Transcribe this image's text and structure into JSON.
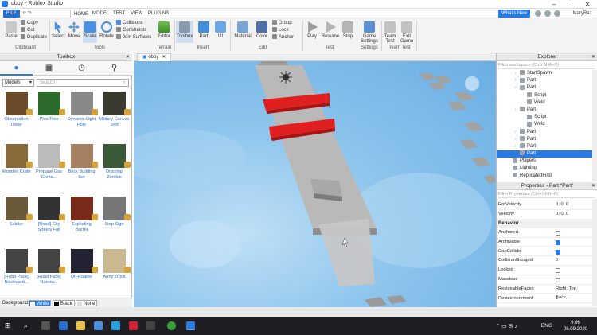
{
  "window": {
    "title": "obby - Roblox Studio"
  },
  "menu": {
    "tabs": [
      "FILE",
      "HOME",
      "MODEL",
      "TEST",
      "VIEW",
      "PLUGINS"
    ],
    "active": "HOME",
    "whats_new": "What's New",
    "user": "MaryRa1"
  },
  "ribbon": {
    "clipboard": {
      "paste": "Paste",
      "copy": "Copy",
      "cut": "Cut",
      "duplicate": "Duplicate",
      "label": "Clipboard"
    },
    "tools": {
      "select": "Select",
      "move": "Move",
      "scale": "Scale",
      "rotate": "Rotate",
      "label": "Tools"
    },
    "options": {
      "collisions": "Collisions",
      "constraints": "Constraints",
      "join_surfaces": "Join Surfaces"
    },
    "terrain": {
      "editor": "Editor",
      "label": "Terrain"
    },
    "insert": {
      "toolbox": "Toolbox",
      "part": "Part",
      "ui": "UI",
      "label": "Insert"
    },
    "edit": {
      "material": "Material",
      "color": "Color",
      "group": "Group",
      "lock": "Lock",
      "anchor": "Anchor",
      "label": "Edit"
    },
    "test": {
      "play": "Play",
      "resume": "Resume",
      "stop": "Stop",
      "label": "Test"
    },
    "settings": {
      "game_settings": "Game Settings",
      "label": "Settings"
    },
    "team_test": {
      "team_test": "Team Test",
      "exit_game": "Exit Game",
      "label": "Team Test"
    }
  },
  "toolbox": {
    "title": "Toolbox",
    "dropdown": "Models",
    "search_placeholder": "Search",
    "items": [
      "Observation Tower",
      "Pine Tree",
      "Dynamic Light Pole",
      "Military Canvas Tent",
      "Wooden Crate",
      "Propane Gas Conta...",
      "Brick Building Set",
      "Drooling Zombie",
      "Soldier",
      "[Road] City Streets Full",
      "Exploding Barrel",
      "Stop Sign",
      "[Road Pack] Boulevard...",
      "[Road Pack] Narrow...",
      "Off-Roader",
      "Army Truck"
    ],
    "background_label": "Background:",
    "bg_options": [
      "White",
      "Black",
      "None"
    ]
  },
  "viewport": {
    "tab": "obby"
  },
  "explorer": {
    "title": "Explorer",
    "filter": "Filter workspace (Ctrl+Shift+X)",
    "rows": [
      {
        "label": "StartSpawn",
        "indent": 1
      },
      {
        "label": "Part",
        "indent": 1
      },
      {
        "label": "Part",
        "indent": 1
      },
      {
        "label": "Script",
        "indent": 2
      },
      {
        "label": "Weld",
        "indent": 2
      },
      {
        "label": "Part",
        "indent": 1
      },
      {
        "label": "Script",
        "indent": 2
      },
      {
        "label": "Weld",
        "indent": 2
      },
      {
        "label": "Part",
        "indent": 1
      },
      {
        "label": "Part",
        "indent": 1
      },
      {
        "label": "Part",
        "indent": 1
      },
      {
        "label": "Part",
        "indent": 1,
        "selected": true
      },
      {
        "label": "Players",
        "indent": 0
      },
      {
        "label": "Lighting",
        "indent": 0
      },
      {
        "label": "ReplicatedFirst",
        "indent": 0
      }
    ]
  },
  "properties": {
    "title": "Properties - Part \"Part\"",
    "filter": "Filter Properties (Ctrl+Shift+P)",
    "rows": [
      {
        "name": "RotVelocity",
        "value": "0, 0, 0"
      },
      {
        "name": "Velocity",
        "value": "0, 0, 0"
      }
    ],
    "section": "Behavior",
    "behavior": [
      {
        "name": "Anchored",
        "checked": false
      },
      {
        "name": "Archivable",
        "checked": true
      },
      {
        "name": "CanCollide",
        "checked": true
      },
      {
        "name": "CollisionGroupId",
        "value": "0"
      },
      {
        "name": "Locked",
        "checked": false
      },
      {
        "name": "Massless",
        "checked": false
      },
      {
        "name": "ResizeableFaces",
        "value": "Right, Top, Back,..."
      },
      {
        "name": "ResizeIncrement",
        "value": "1"
      }
    ]
  },
  "taskbar": {
    "lang": "ENG",
    "time": "9:06",
    "date": "08.09.2020"
  },
  "colors": {
    "accent": "#2a7be4",
    "red_bar": "#e02020",
    "platform": "#b8b8b8"
  }
}
